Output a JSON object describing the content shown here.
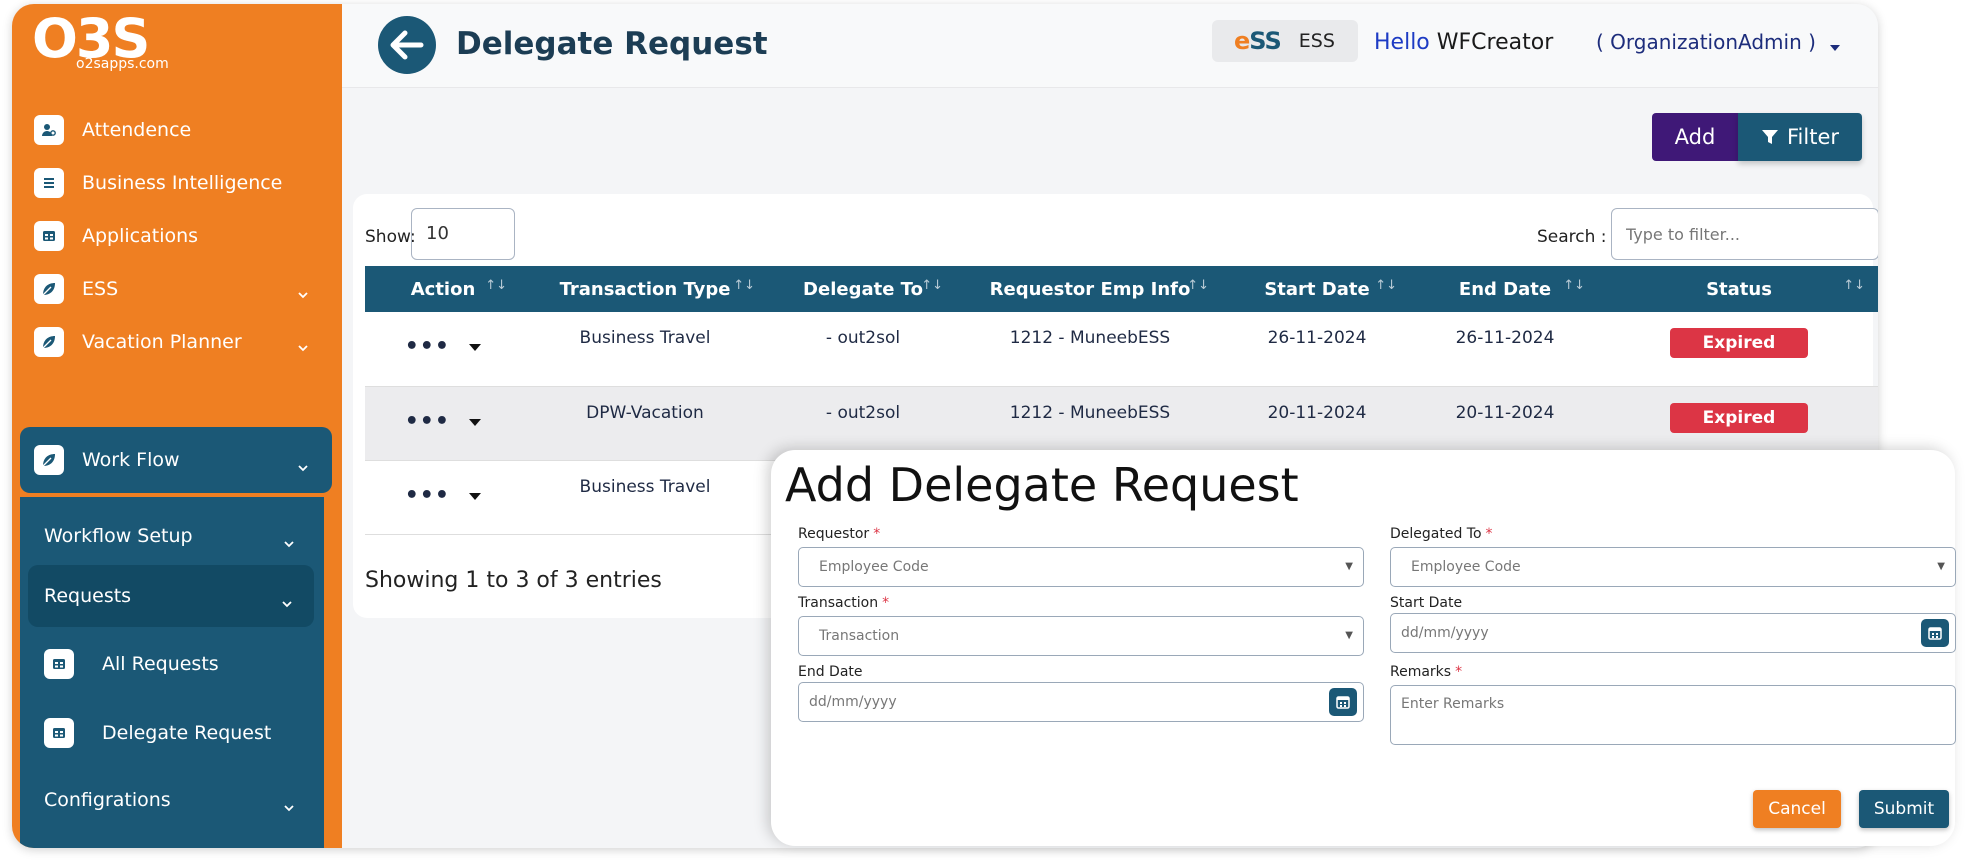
{
  "brand": {
    "logo_text": "O3S",
    "logo_sub": "o2sapps.com"
  },
  "sidebar": {
    "items": [
      {
        "label": "Attendence",
        "icon": "user-icon"
      },
      {
        "label": "Business Intelligence",
        "icon": "list-icon"
      },
      {
        "label": "Applications",
        "icon": "grid-icon"
      },
      {
        "label": "ESS",
        "icon": "leaf-icon"
      },
      {
        "label": "Vacation Planner",
        "icon": "leaf-icon"
      },
      {
        "label": "Work Flow",
        "icon": "leaf-icon"
      }
    ],
    "workflow_submenu": [
      {
        "label": "Workflow Setup"
      },
      {
        "label": "Requests"
      },
      {
        "label": "All Requests"
      },
      {
        "label": "Delegate Request"
      },
      {
        "label": "Configrations"
      }
    ]
  },
  "header": {
    "title": "Delegate Request",
    "ess_logo": "ESS",
    "ess_label": "ESS",
    "hello": "Hello",
    "username": "WFCreator",
    "role": "( OrganizationAdmin )"
  },
  "toolbar": {
    "add_label": "Add",
    "filter_label": "Filter"
  },
  "table": {
    "show_label": "Show:",
    "show_value": "10",
    "search_label": "Search :",
    "search_placeholder": "Type to filter...",
    "columns": [
      "Action",
      "Transaction Type",
      "Delegate To",
      "Requestor Emp Info",
      "Start Date",
      "End Date",
      "Status"
    ],
    "rows": [
      {
        "type": "Business Travel",
        "delegate": "- out2sol",
        "requestor": "1212 - MuneebESS",
        "start": "26-11-2024",
        "end": "26-11-2024",
        "status": "Expired"
      },
      {
        "type": "DPW-Vacation",
        "delegate": "- out2sol",
        "requestor": "1212 - MuneebESS",
        "start": "20-11-2024",
        "end": "20-11-2024",
        "status": "Expired"
      },
      {
        "type": "Business Travel",
        "delegate": "",
        "requestor": "",
        "start": "",
        "end": "",
        "status": ""
      }
    ],
    "entries_text": "Showing 1 to 3 of 3 entries",
    "dots": "•••"
  },
  "modal": {
    "title": "Add Delegate Request",
    "requestor_label": "Requestor",
    "requestor_placeholder": "Employee Code",
    "delegated_to_label": "Delegated To",
    "delegated_to_placeholder": "Employee Code",
    "transaction_label": "Transaction",
    "transaction_placeholder": "Transaction",
    "start_date_label": "Start Date",
    "start_date_placeholder": "dd/mm/yyyy",
    "end_date_label": "End Date",
    "end_date_placeholder": "dd/mm/yyyy",
    "remarks_label": "Remarks",
    "remarks_placeholder": "Enter Remarks",
    "required_mark": "*",
    "cancel_label": "Cancel",
    "submit_label": "Submit"
  },
  "colors": {
    "sidebar_orange": "#ef7f22",
    "primary_teal": "#1b5876",
    "add_purple": "#3f1877",
    "expired_red": "#dc3545"
  }
}
